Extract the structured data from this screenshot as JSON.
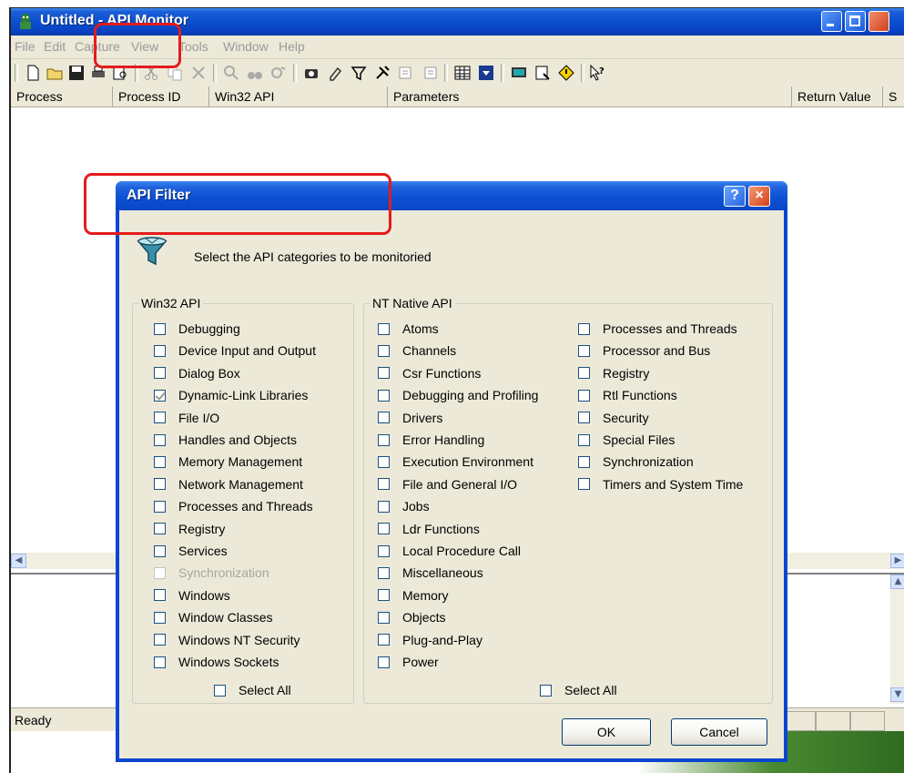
{
  "window": {
    "title": "Untitled - API Monitor",
    "menu": [
      "File",
      "Edit",
      "Capture",
      "View",
      "Tools",
      "Window",
      "Help"
    ],
    "columns": [
      "Process",
      "Process ID",
      "Win32 API",
      "Parameters",
      "Return Value",
      "S"
    ],
    "status": "Ready"
  },
  "dialog": {
    "title": "API Filter",
    "help_glyph": "?",
    "close_glyph": "×",
    "instruction": "Select the API categories to be monitoried",
    "win32": {
      "legend": "Win32 API",
      "items": [
        {
          "label": "Debugging",
          "checked": false,
          "disabled": false
        },
        {
          "label": "Device Input and Output",
          "checked": false,
          "disabled": false
        },
        {
          "label": "Dialog Box",
          "checked": false,
          "disabled": false
        },
        {
          "label": "Dynamic-Link Libraries",
          "checked": true,
          "disabled": false
        },
        {
          "label": "File I/O",
          "checked": false,
          "disabled": false
        },
        {
          "label": "Handles and Objects",
          "checked": false,
          "disabled": false
        },
        {
          "label": "Memory Management",
          "checked": false,
          "disabled": false
        },
        {
          "label": "Network Management",
          "checked": false,
          "disabled": false
        },
        {
          "label": "Processes and Threads",
          "checked": false,
          "disabled": false
        },
        {
          "label": "Registry",
          "checked": false,
          "disabled": false
        },
        {
          "label": "Services",
          "checked": false,
          "disabled": false
        },
        {
          "label": "Synchronization",
          "checked": false,
          "disabled": true
        },
        {
          "label": "Windows",
          "checked": false,
          "disabled": false
        },
        {
          "label": "Window Classes",
          "checked": false,
          "disabled": false
        },
        {
          "label": "Windows NT Security",
          "checked": false,
          "disabled": false
        },
        {
          "label": "Windows Sockets",
          "checked": false,
          "disabled": false
        }
      ],
      "select_all": "Select All"
    },
    "native": {
      "legend": "NT Native API",
      "items_col1": [
        "Atoms",
        "Channels",
        "Csr Functions",
        "Debugging and Profiling",
        "Drivers",
        "Error Handling",
        "Execution Environment",
        "File and General I/O",
        "Jobs",
        "Ldr Functions",
        "Local Procedure Call",
        "Miscellaneous",
        "Memory",
        "Objects",
        "Plug-and-Play",
        "Power"
      ],
      "items_col2": [
        "Processes and Threads",
        "Processor and Bus",
        "Registry",
        "Rtl Functions",
        "Security",
        "Special Files",
        "Synchronization",
        "Timers and System Time"
      ],
      "select_all": "Select All"
    },
    "ok": "OK",
    "cancel": "Cancel"
  },
  "icons": [
    "app-icon",
    "new-file-icon",
    "open-folder-icon",
    "save-icon",
    "print-icon",
    "print-preview-icon",
    "cut-icon",
    "copy-icon",
    "delete-icon",
    "find-icon",
    "binoculars-icon",
    "find-next-icon",
    "capture-icon",
    "eraser-icon",
    "filter-icon",
    "tools-icon",
    "export-icon",
    "import-icon",
    "table-icon",
    "download-icon",
    "monitor-icon",
    "properties-icon",
    "diamond-icon",
    "help-pointer-icon",
    "api-filter-icon"
  ],
  "colors": {
    "titlebar": "#0a4fd0",
    "dialog_face": "#ece9d8",
    "highlight": "#e41b1b"
  }
}
